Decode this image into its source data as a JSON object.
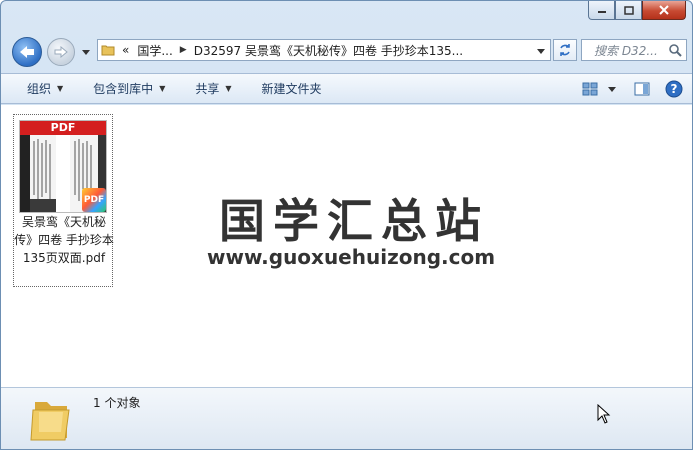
{
  "window": {
    "breadcrumbs": [
      "«",
      "国学...",
      "D32597 吴景鸾《天机秘传》四卷 手抄珍本135..."
    ],
    "search_placeholder": "搜索 D32..."
  },
  "toolbar": {
    "organize": "组织",
    "include_in_library": "包含到库中",
    "share": "共享",
    "new_folder": "新建文件夹"
  },
  "file": {
    "thumb_label": "PDF",
    "badge": "PDF",
    "name": "吴景鸾《天机秘传》四卷 手抄珍本135页双面.pdf"
  },
  "watermark": {
    "title": "国学汇总站",
    "url": "www.guoxuehuizong.com"
  },
  "status": {
    "count": "1 个对象"
  },
  "colors": {
    "accent": "#2f6fc4",
    "close": "#c74a32",
    "pdf_red": "#d41f1f"
  }
}
